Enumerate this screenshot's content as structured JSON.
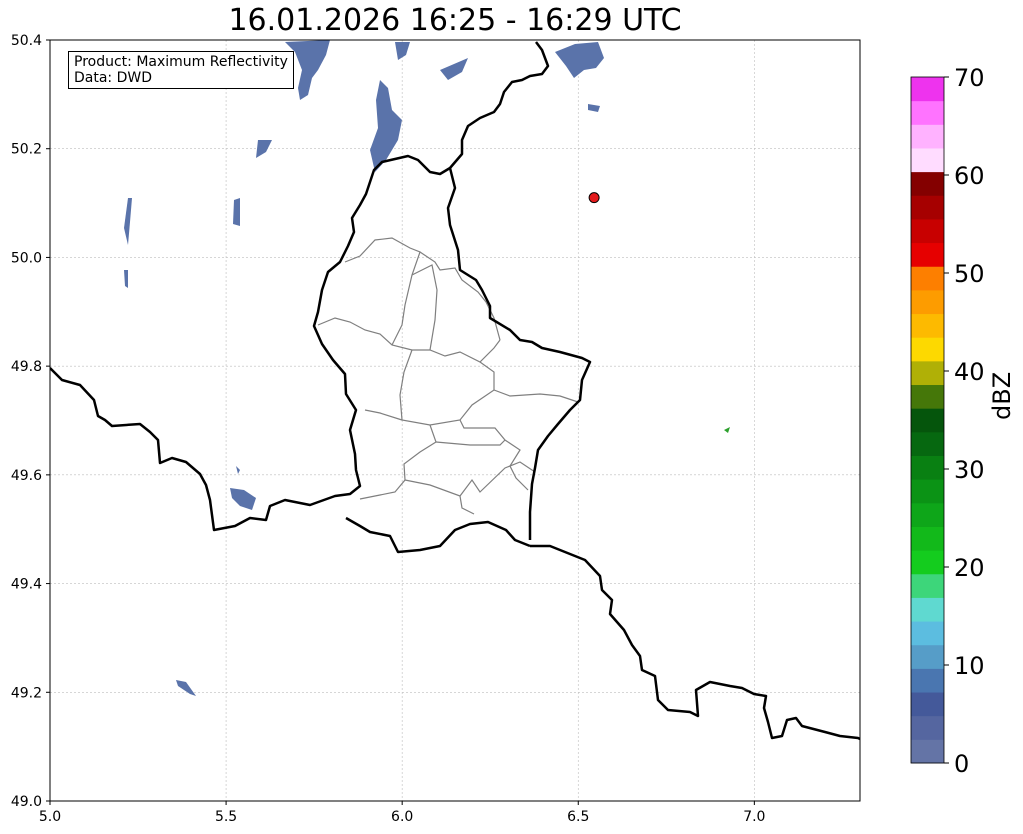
{
  "title": "16.01.2026 16:25 - 16:29 UTC",
  "info_box": {
    "product": "Product: Maximum Reflectivity",
    "data": "Data: DWD"
  },
  "axes": {
    "x_ticks": [
      "5.0",
      "5.5",
      "6.0",
      "6.5",
      "7.0"
    ],
    "y_ticks": [
      "49.0",
      "49.2",
      "49.4",
      "49.6",
      "49.8",
      "50.0",
      "50.2",
      "50.4"
    ],
    "x_range": [
      5.0,
      7.3
    ],
    "y_range": [
      49.0,
      50.4
    ],
    "grid": true
  },
  "marker": {
    "lon": 6.545,
    "lat": 50.11,
    "color": "#e31a1c"
  },
  "colorbar": {
    "label": "dBZ",
    "ticks": [
      "0",
      "10",
      "20",
      "30",
      "40",
      "50",
      "60",
      "70"
    ],
    "colors": [
      "#6474a6",
      "#5566a0",
      "#44599a",
      "#4a76b0",
      "#569dc8",
      "#5cbde0",
      "#5fd9d0",
      "#3dd67a",
      "#14cc1e",
      "#12b91a",
      "#0ea619",
      "#0b9315",
      "#098012",
      "#066810",
      "#05550c",
      "#457709",
      "#b0b006",
      "#fdd900",
      "#fdba00",
      "#fd9c00",
      "#fd7f00",
      "#e60000",
      "#c80000",
      "#a60000",
      "#840000",
      "#ffdcff",
      "#ffb2ff",
      "#ff73ff",
      "#ee33ee"
    ]
  }
}
